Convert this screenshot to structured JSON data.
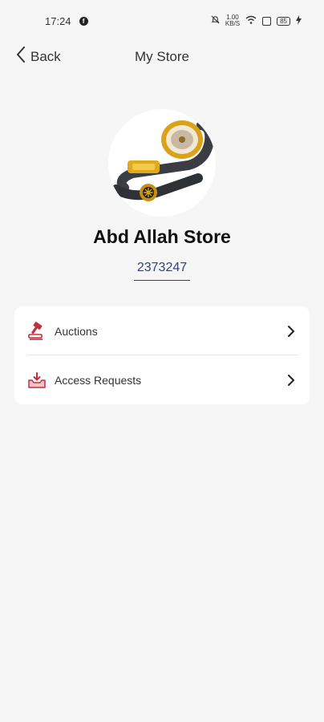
{
  "status_bar": {
    "time": "17:24",
    "speed_top": "1.00",
    "speed_bottom": "KB/S",
    "battery": "85"
  },
  "nav": {
    "back_label": "Back",
    "title": "My Store"
  },
  "store": {
    "name": "Abd Allah Store",
    "id": "2373247"
  },
  "menu": {
    "items": [
      {
        "label": "Auctions",
        "icon": "gavel-icon"
      },
      {
        "label": "Access Requests",
        "icon": "inbox-download-icon"
      }
    ]
  },
  "colors": {
    "background": "#f6f6f6",
    "accent_red": "#c0313f",
    "link_blue": "#2d4379",
    "card": "#ffffff"
  }
}
